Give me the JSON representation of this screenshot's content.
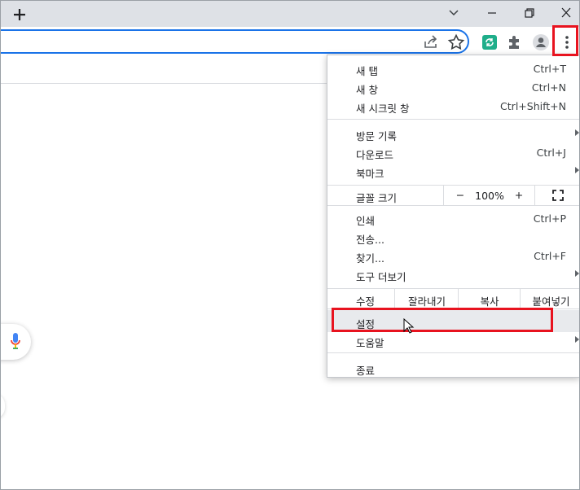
{
  "menu": {
    "new_tab": {
      "label": "새 탭",
      "shortcut": "Ctrl+T"
    },
    "new_window": {
      "label": "새 창",
      "shortcut": "Ctrl+N"
    },
    "new_incognito": {
      "label": "새 시크릿 창",
      "shortcut": "Ctrl+Shift+N"
    },
    "history": {
      "label": "방문 기록"
    },
    "downloads": {
      "label": "다운로드",
      "shortcut": "Ctrl+J"
    },
    "bookmarks": {
      "label": "북마크"
    },
    "zoom": {
      "label": "글꼴 크기",
      "minus": "−",
      "value": "100%",
      "plus": "+"
    },
    "print": {
      "label": "인쇄",
      "shortcut": "Ctrl+P"
    },
    "cast": {
      "label": "전송..."
    },
    "find": {
      "label": "찾기...",
      "shortcut": "Ctrl+F"
    },
    "more_tools": {
      "label": "도구 더보기"
    },
    "edit": {
      "label": "수정",
      "cut": "잘라내기",
      "copy": "복사",
      "paste": "붙여넣기"
    },
    "settings": {
      "label": "설정"
    },
    "help": {
      "label": "도움말"
    },
    "exit": {
      "label": "종료"
    }
  },
  "icons": {
    "new_tab": "plus-icon",
    "tab_search": "chevron-down-icon",
    "minimize": "minimize-icon",
    "restore": "restore-icon",
    "close": "close-icon",
    "share": "share-icon",
    "bookmark": "star-icon",
    "extension": "extension-refresh-icon",
    "extensions": "puzzle-icon",
    "profile": "profile-icon",
    "menu": "kebab-menu-icon",
    "mic": "microphone-icon",
    "fullscreen": "fullscreen-icon",
    "cursor": "mouse-cursor-icon"
  },
  "colors": {
    "highlight_box": "#e8131f",
    "omnibox_border": "#1a73e8",
    "extension_green": "#1fae8a",
    "hover_row": "#e8eaed"
  }
}
